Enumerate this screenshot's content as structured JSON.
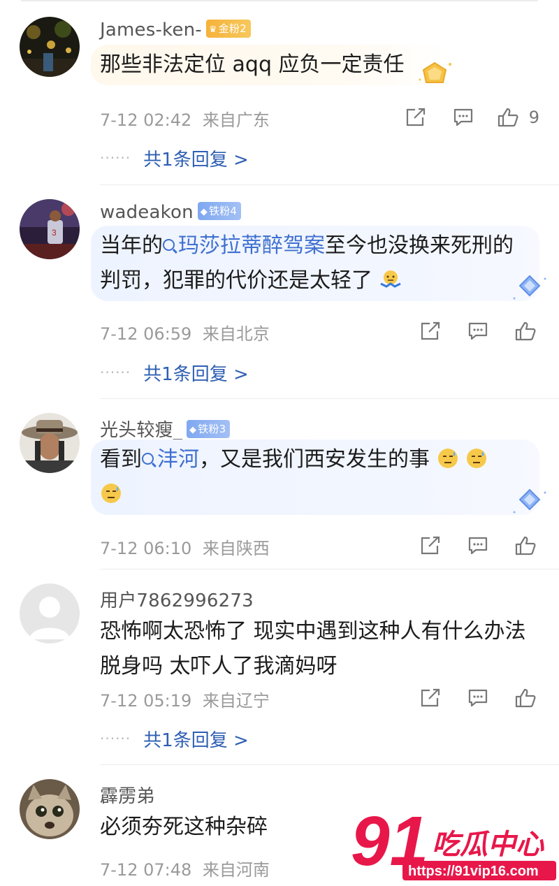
{
  "comments": [
    {
      "username": "James-ken-",
      "badge": "金粉2",
      "lines": [
        "那些非法定位 aqq 应负一定责任"
      ],
      "time": "7-12 02:42",
      "location": "来自广东",
      "likes": "9",
      "replies": "共1条回复 >"
    },
    {
      "username": "wadeakon",
      "badge": "铁粉4",
      "line1_pre": "当年的",
      "line1_topic": "玛莎拉蒂醉驾案",
      "line1_post": "至今也没换来死刑的",
      "line2": "判罚，犯罪的代价还是太轻了",
      "time": "7-12 06:59",
      "location": "来自北京",
      "replies": "共1条回复 >"
    },
    {
      "username": "光头较瘦_",
      "badge": "铁粉3",
      "line1_pre": "看到",
      "line1_topic": "沣河",
      "line1_post": "，又是我们西安发生的事",
      "time": "7-12 06:10",
      "location": "来自陕西"
    },
    {
      "username": "用户7862996273",
      "lines": [
        "恐怖啊太恐怖了 现实中遇到这种人有什么办法",
        "脱身吗 太吓人了我滴妈呀"
      ],
      "time": "7-12 05:19",
      "location": "来自辽宁",
      "replies": "共1条回复 >"
    },
    {
      "username": "霹雳弟",
      "lines": [
        "必须夯死这种杂碎"
      ],
      "time": "7-12 07:48",
      "location": "来自河南"
    }
  ],
  "watermark": {
    "brand_number": "91",
    "brand_text": "吃瓜中心",
    "url": "https://91vip16.com"
  },
  "colors": {
    "link_blue": "#2e5fb3",
    "topic_blue": "#3e6fd0",
    "gold_badge": "#f5b23a",
    "iron_badge": "#7fa8f0",
    "watermark_red": "#e8174a"
  }
}
